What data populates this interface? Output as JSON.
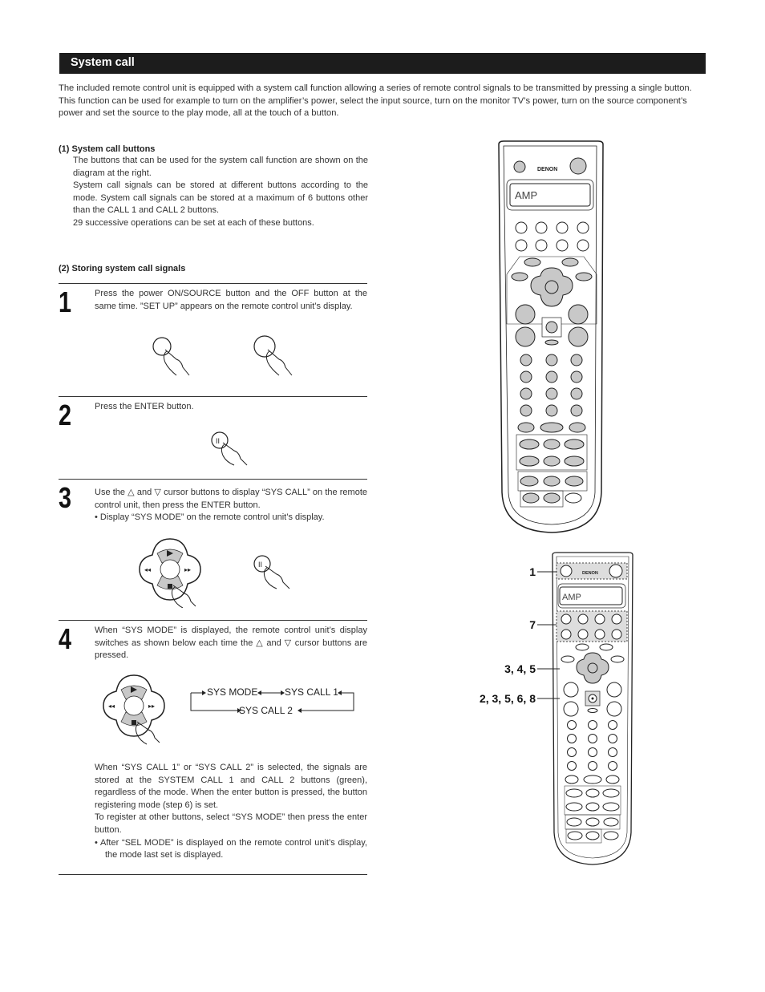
{
  "header": {
    "title": "System call"
  },
  "intro": {
    "paragraphs": [
      "The included remote control unit is equipped with a system call function allowing a series of remote control signals to be transmitted by pressing a single button.",
      "This function can be used for example to turn on the amplifier’s power, select the input source, turn on the monitor TV’s power, turn on the source component’s power and set the source to the play mode, all at the touch of a button."
    ]
  },
  "section1": {
    "heading": "(1) System call buttons",
    "paragraphs": [
      "The buttons that can be used for the system call function are shown on the diagram at the right.",
      "System call signals can be stored at different buttons according to the mode.  System call signals can be stored at a maximum of 6 buttons other than the CALL 1 and CALL 2 buttons.",
      "29 successive operations can be set at each of these buttons."
    ]
  },
  "section2": {
    "heading": "(2) Storing system call signals"
  },
  "steps": [
    {
      "number": "1",
      "text": "Press the power ON/SOURCE button and the OFF button at the same time.  ”SET UP” appears on the remote control unit’s display."
    },
    {
      "number": "2",
      "text": "Press the ENTER button."
    },
    {
      "number": "3",
      "text": "Use the △ and ▽ cursor buttons to display “SYS CALL” on the remote control unit, then press the ENTER button.",
      "bullet": "Display “SYS MODE” on the remote control unit’s display."
    },
    {
      "number": "4",
      "text": "When “SYS MODE” is displayed, the remote control unit’s display switches as shown below each time the △ and ▽ cursor buttons are pressed.",
      "flow": {
        "a": "SYS MODE",
        "b": "SYS CALL 1",
        "c": "SYS CALL 2"
      },
      "text2": "When “SYS CALL 1” or “SYS CALL 2” is selected, the signals are stored at the SYSTEM CALL 1 and CALL 2 buttons (green), regardless of the mode.  When the enter button is pressed, the button registering mode (step 6) is set.",
      "text3": "To register at other buttons, select “SYS MODE” then press the enter button.",
      "bullet": "After “SEL MODE” is displayed on the remote control unit’s display, the mode last set is displayed."
    }
  ],
  "remote": {
    "brand": "DENON",
    "display_text": "AMP"
  },
  "callouts": [
    "1",
    "7",
    "3, 4, 5",
    "2, 3, 5, 6, 8"
  ],
  "colors": {
    "header_bg": "#1c1c1c",
    "button_gray": "#c8c8c8"
  }
}
